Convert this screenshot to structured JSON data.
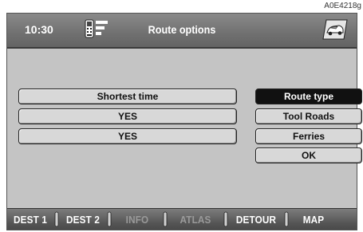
{
  "figure_code": "A0E4218g",
  "header": {
    "time": "10:30",
    "title": "Route options",
    "left_icon": "phone-icon",
    "right_icon": "car-icon"
  },
  "settings": {
    "values": [
      "Shortest time",
      "YES",
      "YES"
    ]
  },
  "options": {
    "items": [
      "Route type",
      "Tool Roads",
      "Ferries",
      "OK"
    ],
    "selected": "Route type"
  },
  "softkeys": {
    "items": [
      {
        "label": "DEST 1",
        "enabled": true
      },
      {
        "label": "DEST 2",
        "enabled": true
      },
      {
        "label": "INFO",
        "enabled": false
      },
      {
        "label": "ATLAS",
        "enabled": false
      },
      {
        "label": "DETOUR",
        "enabled": true
      },
      {
        "label": "MAP",
        "enabled": true
      }
    ]
  },
  "colors": {
    "screen_bg": "#c4c4c4",
    "bar_bg": "#707070",
    "selected_bg": "#111111",
    "disabled_text": "#9a9a9a"
  }
}
